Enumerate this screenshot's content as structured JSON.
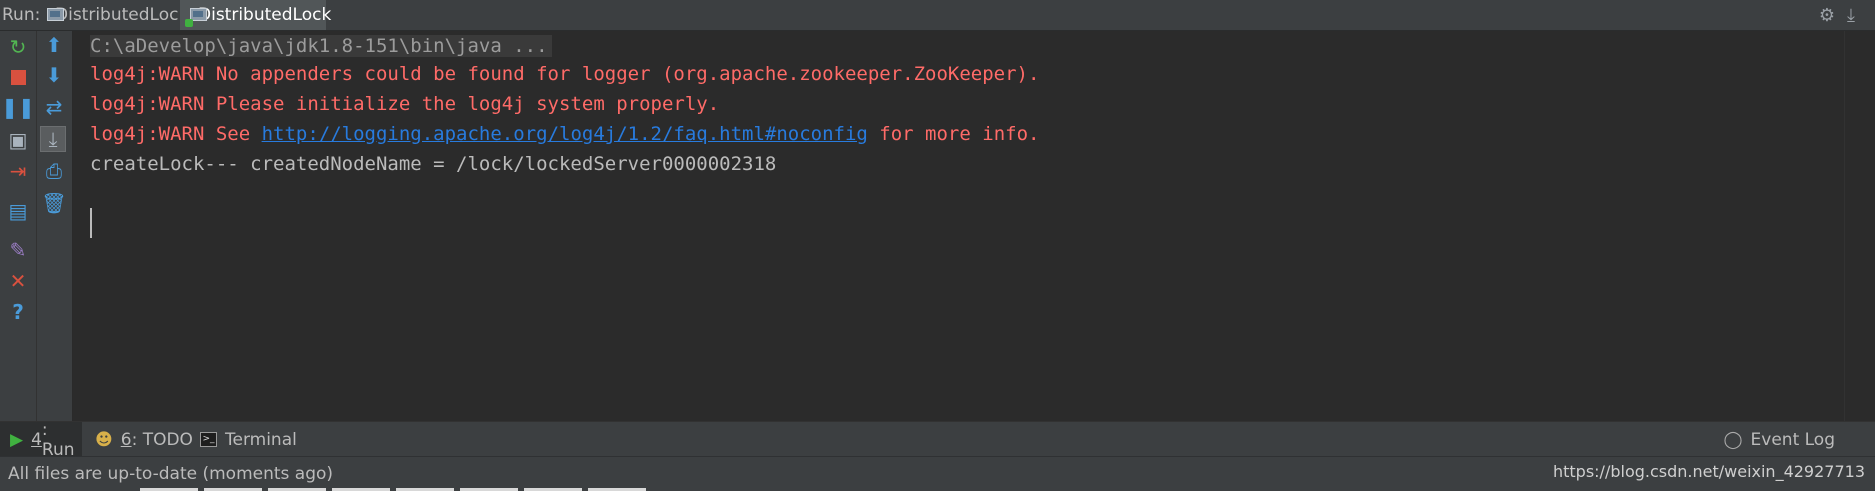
{
  "run_header": {
    "label": "Run:",
    "tabs": [
      {
        "label": "DistributedLock",
        "active": false
      },
      {
        "label": "DistributedLock",
        "active": true
      }
    ],
    "icons": [
      "gear-icon",
      "download-icon"
    ]
  },
  "console": {
    "lines": [
      {
        "text": "C:\\aDevelop\\java\\jdk1.8-151\\bin\\java ...",
        "style": "command"
      },
      {
        "text": "log4j:WARN No appenders could be found for logger (org.apache.zookeeper.ZooKeeper).",
        "style": "warn"
      },
      {
        "text": "log4j:WARN Please initialize the log4j system properly.",
        "style": "warn"
      },
      {
        "prefix": "log4j:WARN See ",
        "link": "http://logging.apache.org/log4j/1.2/faq.html#noconfig",
        "suffix": " for more info.",
        "style": "warn-link"
      },
      {
        "text": "createLock--- createdNodeName = /lock/lockedServer0000002318",
        "style": "normal"
      }
    ]
  },
  "bottom_tabs": [
    {
      "number": "4",
      "label": ": Run",
      "active": true,
      "icon": "run-icon"
    },
    {
      "number": "6",
      "label": ": TODO",
      "active": false,
      "icon": "todo-icon"
    },
    {
      "label": "Terminal",
      "active": false,
      "icon": "terminal-icon"
    }
  ],
  "event_log": {
    "label": "Event Log",
    "icon": "event-log-icon"
  },
  "status": {
    "message": "All files are up-to-date (moments ago)",
    "right_text": "https://blog.csdn.net/weixin_42927713"
  },
  "colors": {
    "background": "#2b2b2b",
    "panel": "#3c3f41",
    "warn": "#ff6b68",
    "link": "#287bde",
    "text": "#bbbbbb"
  }
}
